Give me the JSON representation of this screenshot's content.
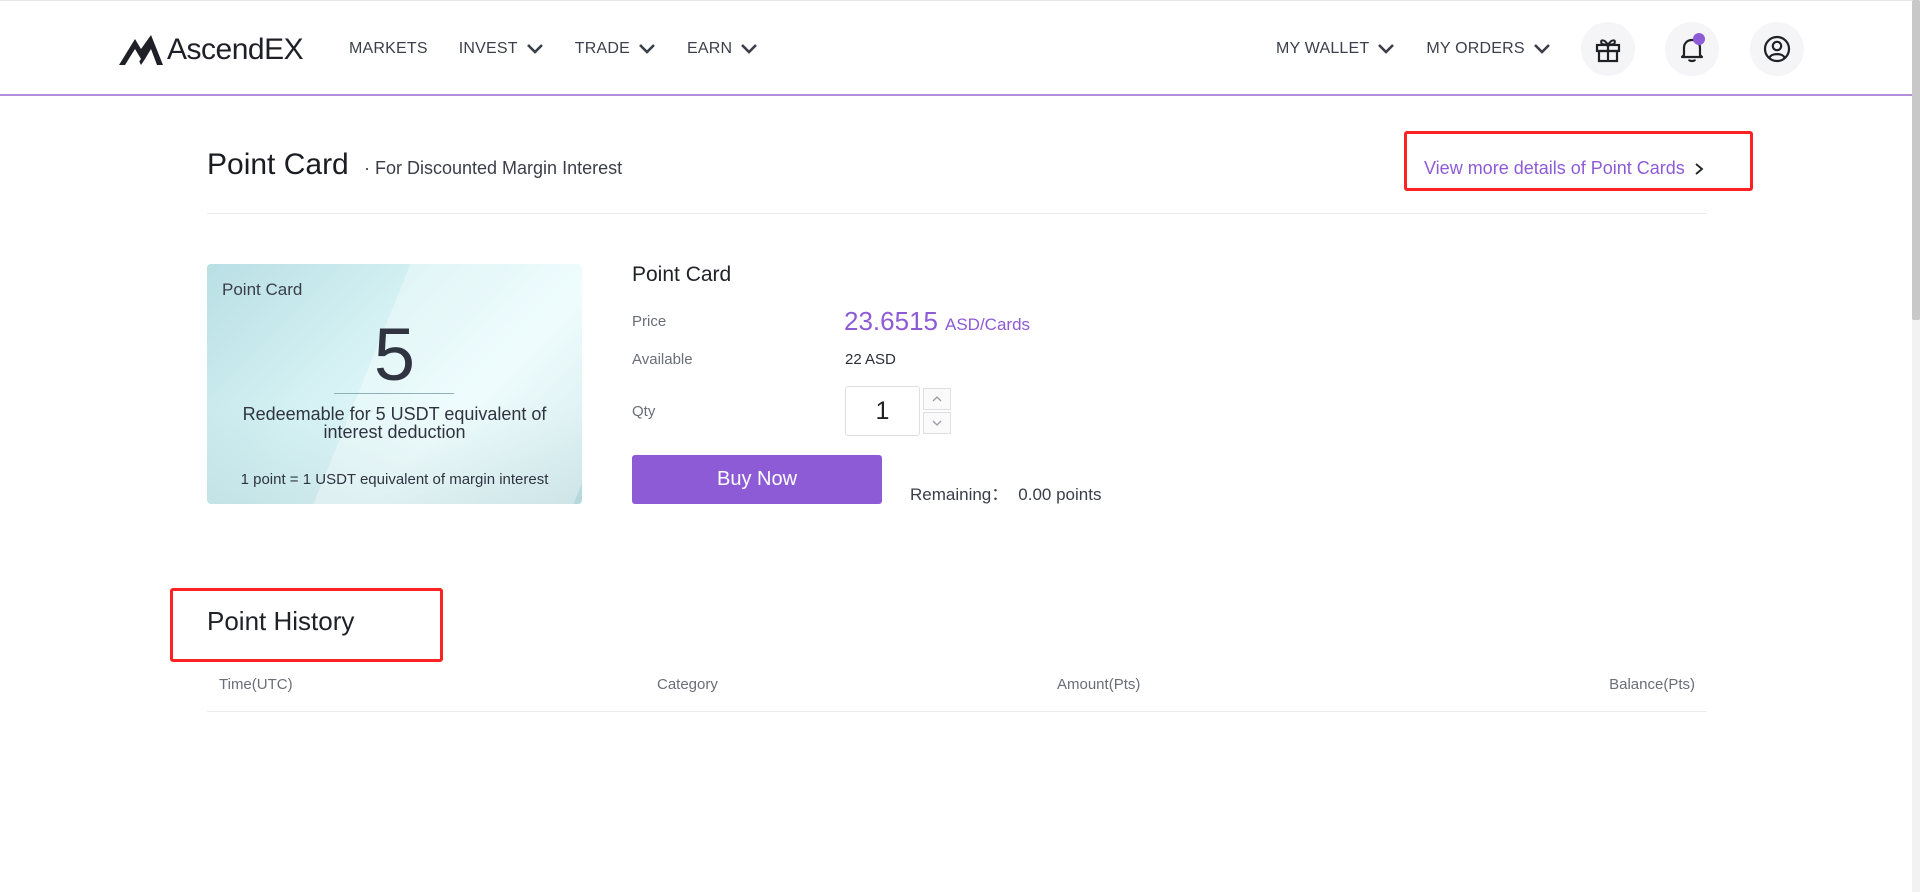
{
  "header": {
    "logo_text": "AscendEX",
    "nav_left": [
      {
        "label": "MARKETS",
        "has_dropdown": false
      },
      {
        "label": "INVEST",
        "has_dropdown": true
      },
      {
        "label": "TRADE",
        "has_dropdown": true
      },
      {
        "label": "EARN",
        "has_dropdown": true
      }
    ],
    "nav_right": [
      {
        "label": "MY WALLET",
        "has_dropdown": true
      },
      {
        "label": "MY ORDERS",
        "has_dropdown": true
      }
    ],
    "icons": [
      "gift-icon",
      "bell-icon",
      "user-icon"
    ],
    "notification_dot": true
  },
  "title_row": {
    "title": "Point Card",
    "subtitle": "· For Discounted Margin Interest",
    "details_link": "View more details of Point Cards"
  },
  "card": {
    "label": "Point Card",
    "number": "5",
    "description": "Redeemable for 5 USDT equivalent of interest deduction",
    "footer": "1 point = 1 USDT equivalent of margin interest"
  },
  "purchase": {
    "title": "Point Card",
    "price_label": "Price",
    "price_value": "23.6515",
    "price_unit": "ASD/Cards",
    "available_label": "Available",
    "available_value": "22 ASD",
    "qty_label": "Qty",
    "qty_value": "1",
    "buy_label": "Buy Now",
    "remaining_label": "Remaining：",
    "remaining_value": "0.00 points"
  },
  "history": {
    "title": "Point History",
    "columns": [
      "Time(UTC)",
      "Category",
      "Amount(Pts)",
      "Balance(Pts)"
    ],
    "rows": []
  },
  "colors": {
    "accent": "#8e5bd6",
    "highlight": "#ff2222"
  }
}
